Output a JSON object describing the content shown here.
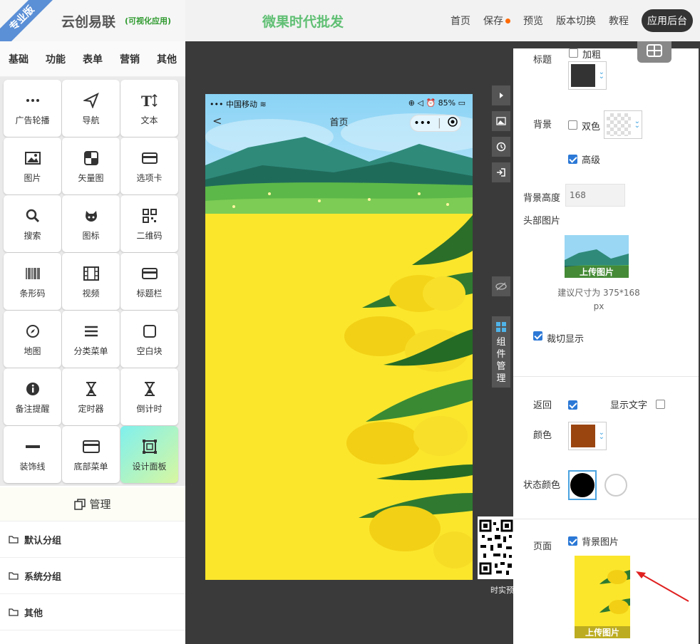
{
  "header": {
    "badge": "专业版",
    "brand": "云创易联",
    "brand_sub": "(可视化应用)",
    "app_title": "微果时代批发",
    "nav": [
      "首页",
      "保存",
      "预览",
      "版本切换",
      "教程"
    ],
    "admin_button": "应用后台",
    "save_dot_color": "#ff6a00"
  },
  "left": {
    "tabs": [
      "基础",
      "功能",
      "表单",
      "营销",
      "其他"
    ],
    "components": [
      {
        "label": "广告轮播",
        "icon": "ellipsis-icon"
      },
      {
        "label": "导航",
        "icon": "send-icon"
      },
      {
        "label": "文本",
        "icon": "text-icon"
      },
      {
        "label": "图片",
        "icon": "image-icon"
      },
      {
        "label": "矢量图",
        "icon": "vector-icon"
      },
      {
        "label": "选项卡",
        "icon": "card-icon"
      },
      {
        "label": "搜索",
        "icon": "search-icon"
      },
      {
        "label": "图标",
        "icon": "github-icon"
      },
      {
        "label": "二维码",
        "icon": "qrcode-icon"
      },
      {
        "label": "条形码",
        "icon": "barcode-icon"
      },
      {
        "label": "视频",
        "icon": "film-icon"
      },
      {
        "label": "标题栏",
        "icon": "titlebar-icon"
      },
      {
        "label": "地图",
        "icon": "compass-icon"
      },
      {
        "label": "分类菜单",
        "icon": "menu-icon"
      },
      {
        "label": "空白块",
        "icon": "square-icon"
      },
      {
        "label": "备注提醒",
        "icon": "info-icon"
      },
      {
        "label": "定时器",
        "icon": "hourglass-icon"
      },
      {
        "label": "倒计时",
        "icon": "hourglass-icon"
      },
      {
        "label": "装饰线",
        "icon": "line-icon"
      },
      {
        "label": "底部菜单",
        "icon": "card-icon"
      },
      {
        "label": "设计面板",
        "icon": "design-icon"
      }
    ],
    "manage_label": "管理",
    "groups": [
      "默认分组",
      "系统分组",
      "其他"
    ]
  },
  "phone": {
    "carrier": "中国移动",
    "battery": "85%",
    "title": "首页",
    "capsule": "•••"
  },
  "toolbar": {
    "component_manager": [
      "组",
      "件",
      "管",
      "理"
    ],
    "qr_label": "时实预览"
  },
  "right": {
    "title_label": "标题",
    "bold_label": "加粗",
    "title_color": "#333333",
    "bg_label": "背景",
    "dual_color_label": "双色",
    "advanced_label": "高级",
    "bg_height_label": "背景高度",
    "bg_height_value": "168",
    "header_image_label": "头部图片",
    "upload_label": "上传图片",
    "size_hint": "建议尺寸为 375*168 px",
    "crop_label": "裁切显示",
    "back_label": "返回",
    "show_text_label": "显示文字",
    "color_label": "颜色",
    "back_color": "#9a4410",
    "status_color_label": "状态颜色",
    "page_label": "页面",
    "bg_image_label": "背景图片",
    "page_upload_label": "上传图片"
  }
}
